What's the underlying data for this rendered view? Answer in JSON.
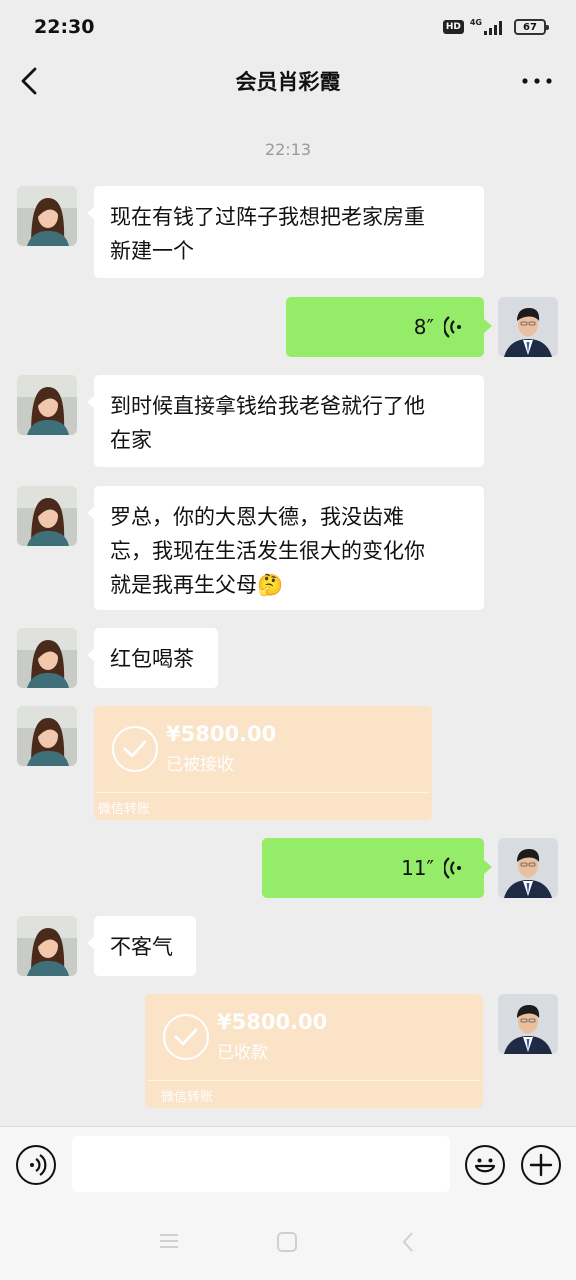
{
  "status_bar": {
    "time": "22:30",
    "hd": "HD",
    "network": "4G",
    "battery": "67"
  },
  "header": {
    "title": "会员肖彩霞",
    "back_icon": "chevron-left-icon",
    "more_icon": "more-dots-icon"
  },
  "chat": {
    "timestamp": "22:13",
    "messages": [
      {
        "side": "left",
        "type": "text",
        "lines": [
          "现在有钱了过阵子我想把老家房重",
          "新建一个"
        ]
      },
      {
        "side": "right",
        "type": "voice",
        "duration": "8″"
      },
      {
        "side": "left",
        "type": "text",
        "lines": [
          "到时候直接拿钱给我老爸就行了他",
          "在家"
        ]
      },
      {
        "side": "left",
        "type": "text",
        "lines": [
          "罗总，你的大恩大德，我没齿难",
          "忘，我现在生活发生很大的变化你",
          "就是我再生父母🤔"
        ]
      },
      {
        "side": "left",
        "type": "text",
        "lines": [
          "红包喝茶"
        ]
      },
      {
        "side": "left",
        "type": "transfer",
        "amount": "¥5800.00",
        "status": "已被接收",
        "label": "微信转账"
      },
      {
        "side": "right",
        "type": "voice",
        "duration": "11″"
      },
      {
        "side": "left",
        "type": "text",
        "lines": [
          "不客气"
        ]
      },
      {
        "side": "right",
        "type": "transfer",
        "amount": "¥5800.00",
        "status": "已收款",
        "label": "微信转账"
      }
    ]
  },
  "input_bar": {
    "voice_icon": "voice-mode-icon",
    "emoji_icon": "emoji-icon",
    "plus_icon": "plus-icon",
    "text_value": ""
  },
  "colors": {
    "background": "#ededed",
    "sent_bubble": "#95ec69",
    "received_bubble": "#ffffff",
    "transfer_bubble": "#fce3c6"
  }
}
